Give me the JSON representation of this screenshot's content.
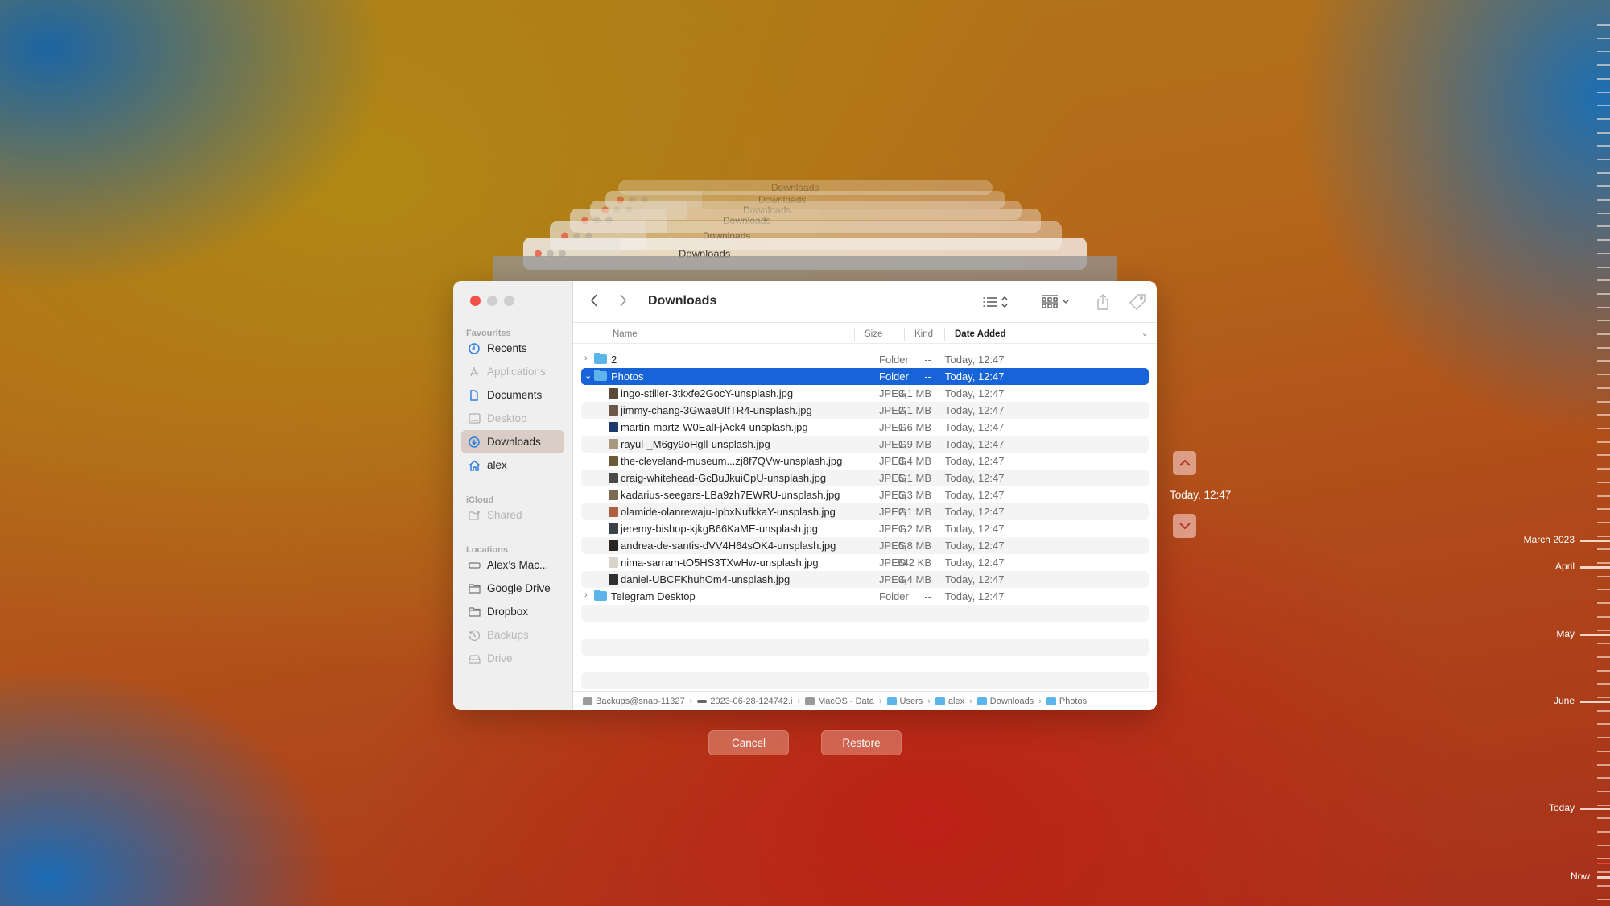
{
  "window": {
    "title": "Downloads",
    "ghost_titles": [
      "Downloads",
      "Downloads",
      "Downloads",
      "Downloads",
      "Downloads",
      "Downloads"
    ]
  },
  "sidebar": {
    "sections": [
      {
        "label": "Favourites",
        "items": [
          {
            "label": "Recents",
            "icon": "clock-icon",
            "dim": false,
            "active": false
          },
          {
            "label": "Applications",
            "icon": "applications-icon",
            "dim": true,
            "active": false
          },
          {
            "label": "Documents",
            "icon": "document-icon",
            "dim": false,
            "active": false
          },
          {
            "label": "Desktop",
            "icon": "desktop-icon",
            "dim": true,
            "active": false
          },
          {
            "label": "Downloads",
            "icon": "download-icon",
            "dim": false,
            "active": true
          },
          {
            "label": "alex",
            "icon": "home-icon",
            "dim": false,
            "active": false
          }
        ]
      },
      {
        "label": "iCloud",
        "items": [
          {
            "label": "Shared",
            "icon": "shared-folder-icon",
            "dim": true,
            "active": false
          }
        ]
      },
      {
        "label": "Locations",
        "items": [
          {
            "label": "Alex’s Mac...",
            "icon": "drive-icon",
            "dim": false,
            "active": false
          },
          {
            "label": "Google Drive",
            "icon": "folder-icon",
            "dim": false,
            "active": false
          },
          {
            "label": "Dropbox",
            "icon": "folder-icon",
            "dim": false,
            "active": false
          },
          {
            "label": "Backups",
            "icon": "time-machine-icon",
            "dim": true,
            "active": false
          },
          {
            "label": "Drive",
            "icon": "external-drive-icon",
            "dim": true,
            "active": false
          }
        ]
      }
    ]
  },
  "columns": {
    "name": "Name",
    "size": "Size",
    "kind": "Kind",
    "date": "Date Added"
  },
  "files": [
    {
      "name": "2",
      "size": "--",
      "kind": "Folder",
      "date": "Today, 12:47",
      "type": "folder",
      "expanded": false,
      "level": 0
    },
    {
      "name": "Photos",
      "size": "--",
      "kind": "Folder",
      "date": "Today, 12:47",
      "type": "folder",
      "expanded": true,
      "level": 0,
      "selected": true
    },
    {
      "name": "ingo-stiller-3tkxfe2GocY-unsplash.jpg",
      "size": "3,1 MB",
      "kind": "JPEG",
      "date": "Today, 12:47",
      "type": "image",
      "level": 1,
      "thumb": "#5a4a3a"
    },
    {
      "name": "jimmy-chang-3GwaeUIfTR4-unsplash.jpg",
      "size": "2,1 MB",
      "kind": "JPEG",
      "date": "Today, 12:47",
      "type": "image",
      "level": 1,
      "thumb": "#6b5848"
    },
    {
      "name": "martin-martz-W0EalFjAck4-unsplash.jpg",
      "size": "1,6 MB",
      "kind": "JPEG",
      "date": "Today, 12:47",
      "type": "image",
      "level": 1,
      "thumb": "#1e3a6a"
    },
    {
      "name": "rayul-_M6gy9oHgll-unsplash.jpg",
      "size": "1,9 MB",
      "kind": "JPEG",
      "date": "Today, 12:47",
      "type": "image",
      "level": 1,
      "thumb": "#a89a80"
    },
    {
      "name": "the-cleveland-museum...zj8f7QVw-unsplash.jpg",
      "size": "8,4 MB",
      "kind": "JPEG",
      "date": "Today, 12:47",
      "type": "image",
      "level": 1,
      "thumb": "#6a5a38"
    },
    {
      "name": "craig-whitehead-GcBuJkuiCpU-unsplash.jpg",
      "size": "5,1 MB",
      "kind": "JPEG",
      "date": "Today, 12:47",
      "type": "image",
      "level": 1,
      "thumb": "#4a4a48"
    },
    {
      "name": "kadarius-seegars-LBa9zh7EWRU-unsplash.jpg",
      "size": "5,3 MB",
      "kind": "JPEG",
      "date": "Today, 12:47",
      "type": "image",
      "level": 1,
      "thumb": "#7a6a50"
    },
    {
      "name": "olamide-olanrewaju-IpbxNufkkaY-unsplash.jpg",
      "size": "2,1 MB",
      "kind": "JPEG",
      "date": "Today, 12:47",
      "type": "image",
      "level": 1,
      "thumb": "#b06040"
    },
    {
      "name": "jeremy-bishop-kjkgB66KaME-unsplash.jpg",
      "size": "1,2 MB",
      "kind": "JPEG",
      "date": "Today, 12:47",
      "type": "image",
      "level": 1,
      "thumb": "#3a4048"
    },
    {
      "name": "andrea-de-santis-dVV4H64sOK4-unsplash.jpg",
      "size": "5,8 MB",
      "kind": "JPEG",
      "date": "Today, 12:47",
      "type": "image",
      "level": 1,
      "thumb": "#2a2420"
    },
    {
      "name": "nima-sarram-tO5HS3TXwHw-unsplash.jpg",
      "size": "842 KB",
      "kind": "JPEG",
      "date": "Today, 12:47",
      "type": "image",
      "level": 1,
      "thumb": "#d8d4cc"
    },
    {
      "name": "daniel-UBCFKhuhOm4-unsplash.jpg",
      "size": "3,4 MB",
      "kind": "JPEG",
      "date": "Today, 12:47",
      "type": "image",
      "level": 1,
      "thumb": "#303030"
    },
    {
      "name": "Telegram Desktop",
      "size": "--",
      "kind": "Folder",
      "date": "Today, 12:47",
      "type": "folder",
      "expanded": false,
      "level": 0
    }
  ],
  "pathbar": [
    {
      "label": "Backups@snap-11327",
      "icon": "disk-icon"
    },
    {
      "label": "2023-06-28-124742.i",
      "icon": "snapshot-icon"
    },
    {
      "label": "MacOS - Data",
      "icon": "disk-icon"
    },
    {
      "label": "Users",
      "icon": "folder-icon"
    },
    {
      "label": "alex",
      "icon": "folder-icon"
    },
    {
      "label": "Downloads",
      "icon": "folder-icon"
    },
    {
      "label": "Photos",
      "icon": "folder-icon"
    }
  ],
  "buttons": {
    "cancel": "Cancel",
    "restore": "Restore"
  },
  "snapshot": {
    "current_label": "Today, 12:47"
  },
  "timeline": {
    "labels": [
      "March 2023",
      "April",
      "May",
      "June",
      "Today",
      "Now"
    ]
  },
  "colors": {
    "selection": "#1763d8",
    "close": "#f2504a",
    "now_marker": "#ff3b30"
  }
}
